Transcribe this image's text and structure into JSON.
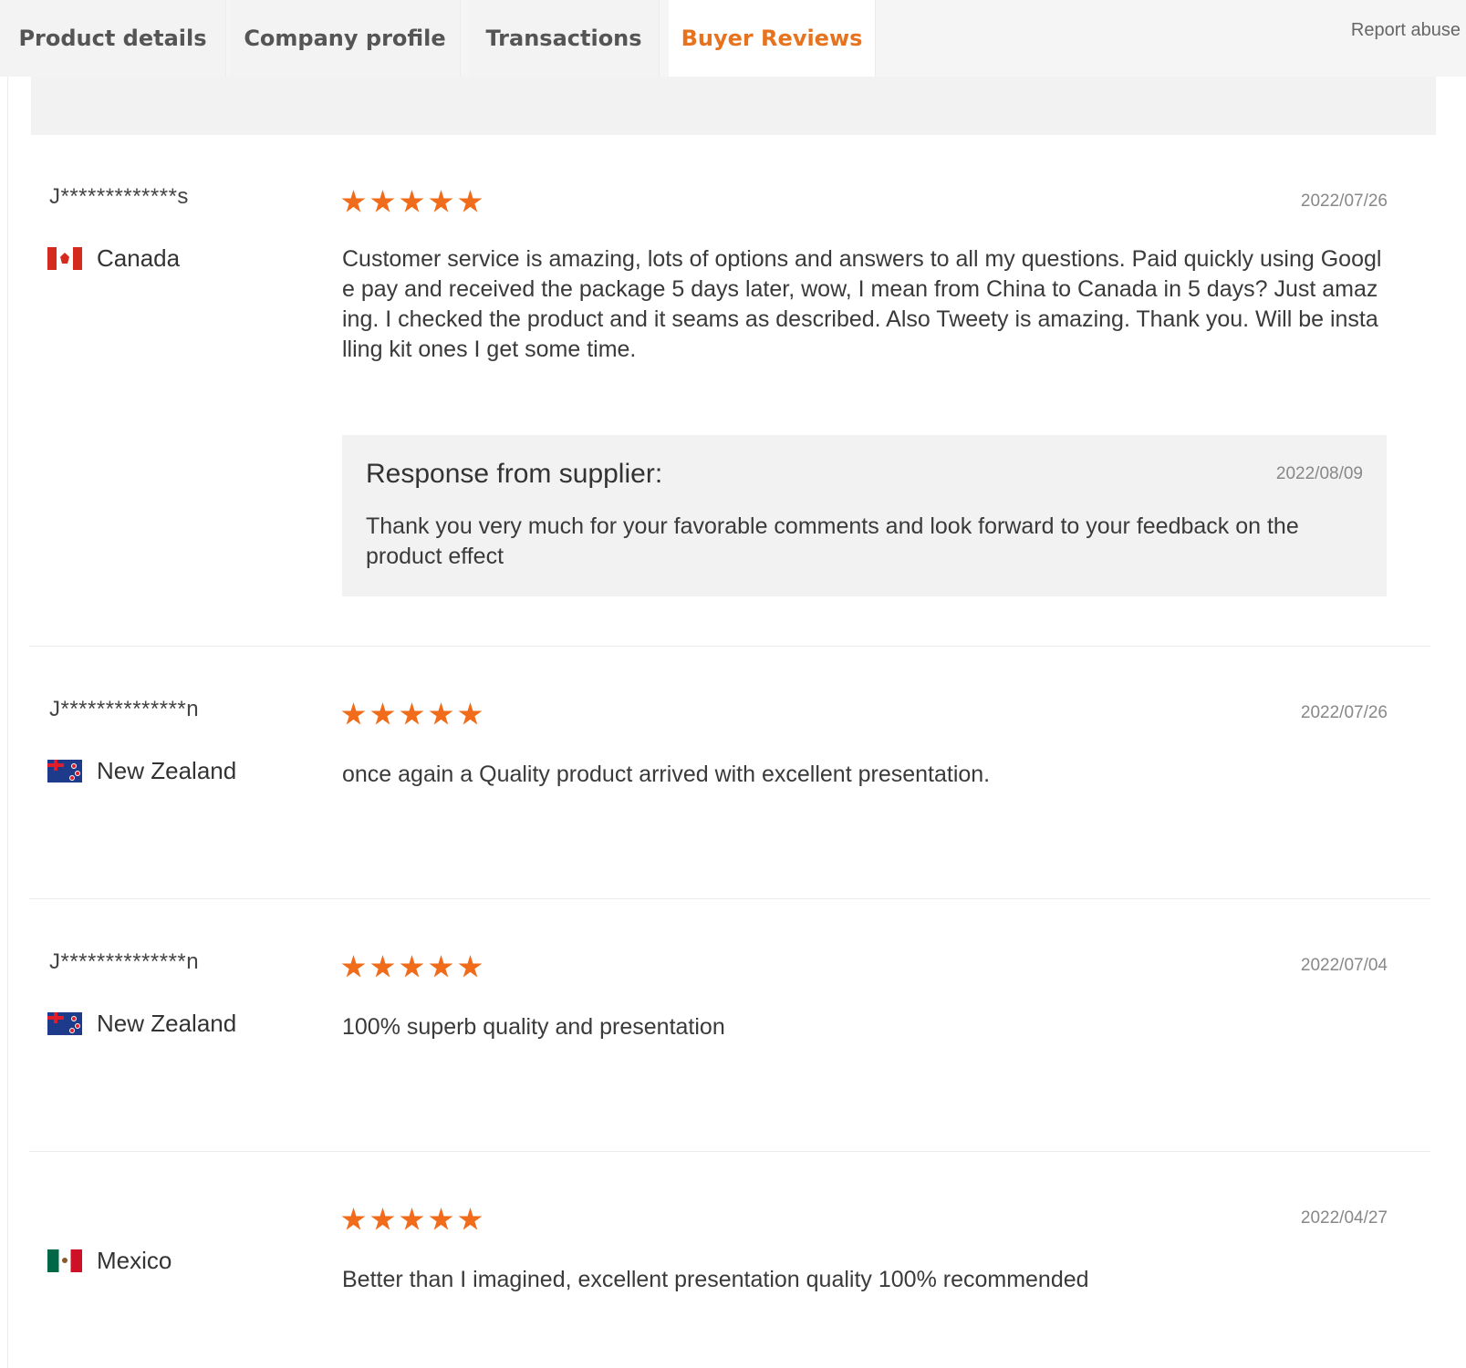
{
  "tabs": [
    {
      "label": "Product details",
      "active": false
    },
    {
      "label": "Company profile",
      "active": false
    },
    {
      "label": "Transactions",
      "active": false
    },
    {
      "label": "Buyer Reviews",
      "active": true
    }
  ],
  "report_abuse": "Report abuse",
  "accent_color": "#e8731e",
  "star_color": "#f06b1a",
  "reviews": [
    {
      "buyer": "J*************s",
      "country": "Canada",
      "flag": "canada-flag",
      "rating": 5,
      "date": "2022/07/26",
      "text": "Customer service is amazing, lots of options and answers to all my questions. Paid quickly using Google pay and received the package 5 days later, wow, I mean from China to Canada in 5 days? Just amazing. I checked the product and it seams as described. Also Tweety is amazing. Thank you. Will be installing kit ones I get some time.",
      "response": {
        "title": "Response from supplier:",
        "date": "2022/08/09",
        "text": "Thank you very much for your favorable comments and look forward to your feedback on the product effect"
      }
    },
    {
      "buyer": "J**************n",
      "country": "New Zealand",
      "flag": "new-zealand-flag",
      "rating": 5,
      "date": "2022/07/26",
      "text": "once again a Quality product arrived with excellent presentation."
    },
    {
      "buyer": "J**************n",
      "country": "New Zealand",
      "flag": "new-zealand-flag",
      "rating": 5,
      "date": "2022/07/04",
      "text": "100% superb quality and presentation"
    },
    {
      "buyer": "",
      "country": "Mexico",
      "flag": "mexico-flag",
      "rating": 5,
      "date": "2022/04/27",
      "text": "Better than I imagined, excellent presentation quality 100% recommended"
    }
  ]
}
